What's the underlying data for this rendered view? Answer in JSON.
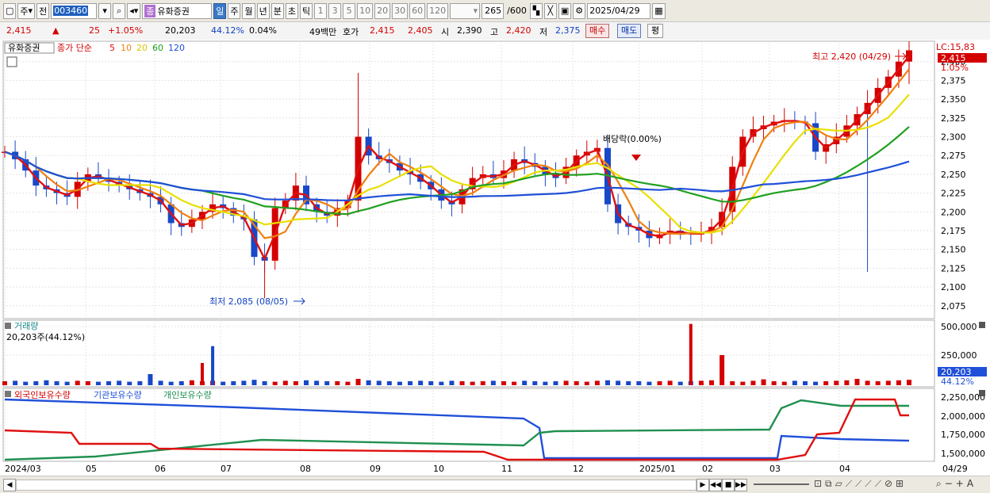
{
  "toolbar": {
    "type_label": "주",
    "prev_label": "전",
    "code": "003460",
    "name": "유화증권",
    "badge": "종",
    "periods": [
      "일",
      "주",
      "월",
      "년",
      "분",
      "초",
      "틱"
    ],
    "intervals": [
      "1",
      "3",
      "5",
      "10",
      "20",
      "30",
      "60",
      "120"
    ],
    "count_value": "265",
    "count_total": "/600",
    "date": "2025/04/29"
  },
  "info": {
    "price": "2,415",
    "arrow": "▲",
    "change": "25",
    "change_pct": "+1.05%",
    "volume": "20,203",
    "vol_ratio": "44.12%",
    "turnover": "0.04%",
    "amount": "49백만",
    "bid_label": "호가",
    "ask_price": "2,415",
    "bid_price": "2,405",
    "open_label": "시",
    "open": "2,390",
    "high_label": "고",
    "high": "2,420",
    "low_label": "저",
    "low": "2,375",
    "buy_label": "매수",
    "sell_label": "매도",
    "eq_label": "평"
  },
  "legend": {
    "name": "유화증권",
    "ma_type": "종가 단순",
    "ma5": "5",
    "ma10": "10",
    "ma20": "20",
    "ma60": "60",
    "ma120": "120",
    "lc": "LC:15,83",
    "current_price_tag": "2,415",
    "current_pct_tag": "1.05%"
  },
  "annotations": {
    "high": "최고 2,420 (04/29)",
    "low": "최저 2,085 (08/05)",
    "dividend": "배당락(0.00%)"
  },
  "volume_panel": {
    "title": "거래량",
    "current": "20,203주(44.12%)",
    "tag": "20,203",
    "tag_pct": "44.12%"
  },
  "holdings_panel": {
    "foreign": "외국인보유수량",
    "institution": "기관보유수량",
    "individual": "개인보유수량"
  },
  "colors": {
    "up": "#d40000",
    "down": "#1848c8",
    "ma5": "#e01010",
    "ma10": "#f08010",
    "ma20": "#e8e000",
    "ma60": "#20a020",
    "ma120": "#2050d8",
    "foreign": "#e01010",
    "institution": "#2050d8",
    "individual": "#209050"
  },
  "chart_data": {
    "type": "line",
    "price_axis": {
      "ticks": [
        "2,400",
        "2,375",
        "2,350",
        "2,325",
        "2,300",
        "2,275",
        "2,250",
        "2,225",
        "2,200",
        "2,175",
        "2,150",
        "2,125",
        "2,100",
        "2,075"
      ]
    },
    "volume_axis": {
      "ticks": [
        "500,000",
        "250,000"
      ]
    },
    "holdings_axis": {
      "ticks": [
        "2,250,000",
        "2,000,000",
        "1,750,000",
        "1,500,000"
      ]
    },
    "x_ticks": [
      "2024/03",
      "05",
      "06",
      "07",
      "08",
      "09",
      "10",
      "11",
      "12",
      "2025/01",
      "02",
      "03",
      "04",
      "04/29"
    ],
    "price_close": [
      2280,
      2270,
      2255,
      2235,
      2230,
      2225,
      2220,
      2240,
      2250,
      2245,
      2240,
      2235,
      2230,
      2225,
      2220,
      2210,
      2185,
      2180,
      2190,
      2200,
      2210,
      2205,
      2195,
      2190,
      2140,
      2135,
      2205,
      2215,
      2235,
      2210,
      2200,
      2195,
      2205,
      2215,
      2300,
      2275,
      2270,
      2265,
      2255,
      2250,
      2240,
      2230,
      2215,
      2210,
      2230,
      2245,
      2250,
      2245,
      2255,
      2270,
      2265,
      2260,
      2250,
      2245,
      2260,
      2275,
      2280,
      2285,
      2210,
      2185,
      2180,
      2175,
      2165,
      2170,
      2175,
      2172,
      2170,
      2172,
      2180,
      2200,
      2260,
      2300,
      2310,
      2315,
      2320,
      2322,
      2320,
      2318,
      2280,
      2290,
      2300,
      2315,
      2330,
      2345,
      2365,
      2380,
      2400,
      2415
    ],
    "ma_names": [
      "5",
      "10",
      "20",
      "60",
      "120"
    ],
    "volume_bars": [
      5,
      6,
      4,
      5,
      7,
      5,
      4,
      6,
      5,
      4,
      5,
      6,
      4,
      5,
      20,
      6,
      4,
      5,
      7,
      5,
      6,
      4,
      5,
      6,
      8,
      5,
      4,
      6,
      5,
      7,
      6,
      5,
      5,
      4,
      10,
      7,
      6,
      5,
      4,
      5,
      6,
      5,
      4,
      6,
      5,
      4,
      5,
      6,
      5,
      4,
      6,
      5,
      4,
      5,
      6,
      5,
      4,
      6,
      7,
      6,
      5,
      5,
      4,
      5,
      6,
      4,
      5,
      6,
      7,
      60,
      5,
      4,
      6,
      9,
      5,
      4,
      6,
      5,
      4,
      5,
      6,
      7,
      10,
      6,
      5,
      6,
      7,
      8
    ],
    "volume_spikes": [
      {
        "i": 19,
        "v": 330000,
        "dir": "up"
      },
      {
        "i": 20,
        "v": 580000,
        "dir": "down"
      },
      {
        "i": 66,
        "v": 910000,
        "dir": "up"
      }
    ]
  }
}
